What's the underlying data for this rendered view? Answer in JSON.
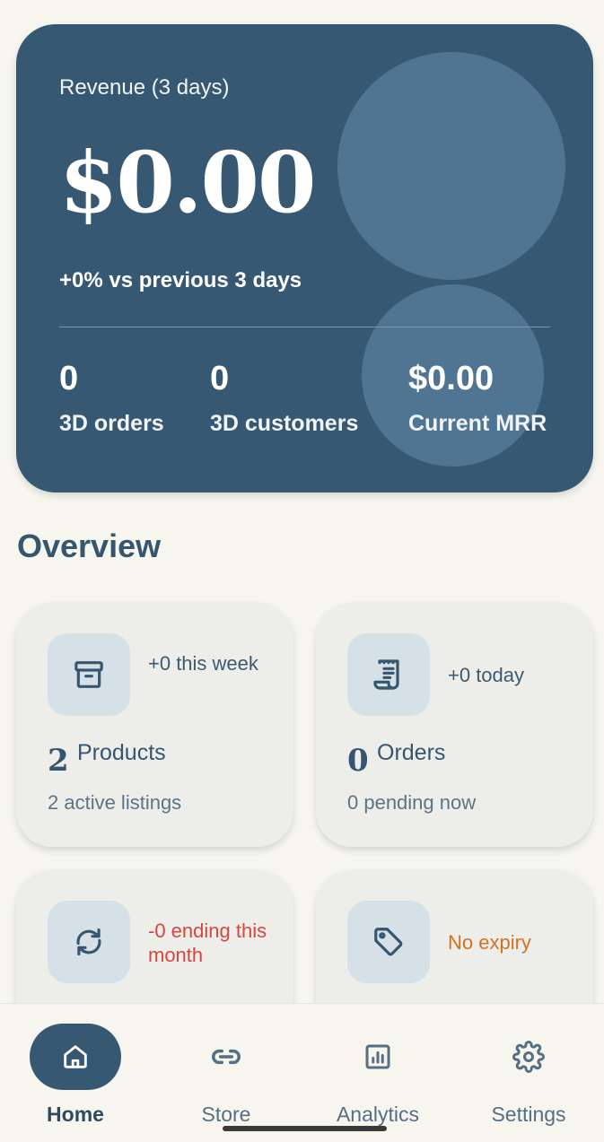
{
  "revenue": {
    "title": "Revenue (3 days)",
    "amount": "$0.00",
    "comparison": "+0% vs previous 3 days",
    "stats": [
      {
        "value": "0",
        "label": "3D orders"
      },
      {
        "value": "0",
        "label": "3D customers"
      },
      {
        "value": "$0.00",
        "label": "Current MRR"
      }
    ]
  },
  "overview": {
    "title": "Overview",
    "tiles": [
      {
        "icon": "archive-icon",
        "note": "+0 this week",
        "count": "2",
        "name": "Products",
        "sub": "2 active listings"
      },
      {
        "icon": "receipt-icon",
        "note": "+0 today",
        "count": "0",
        "name": "Orders",
        "sub": "0 pending now"
      },
      {
        "icon": "refresh-icon",
        "note": "-0 ending this month",
        "note_color": "#d8453d"
      },
      {
        "icon": "tag-icon",
        "note": "No expiry",
        "note_color": "#d37123"
      }
    ]
  },
  "nav": {
    "items": [
      {
        "label": "Home",
        "icon": "home-icon",
        "active": true
      },
      {
        "label": "Store",
        "icon": "link-icon",
        "active": false
      },
      {
        "label": "Analytics",
        "icon": "analytics-icon",
        "active": false
      },
      {
        "label": "Settings",
        "icon": "gear-icon",
        "active": false
      }
    ]
  },
  "colors": {
    "primary": "#365873",
    "background": "#f6f6ef",
    "tile": "#edeeea",
    "icon_box": "#d5e1e6",
    "warning": "#d8453d",
    "accent_orange": "#d37123"
  }
}
